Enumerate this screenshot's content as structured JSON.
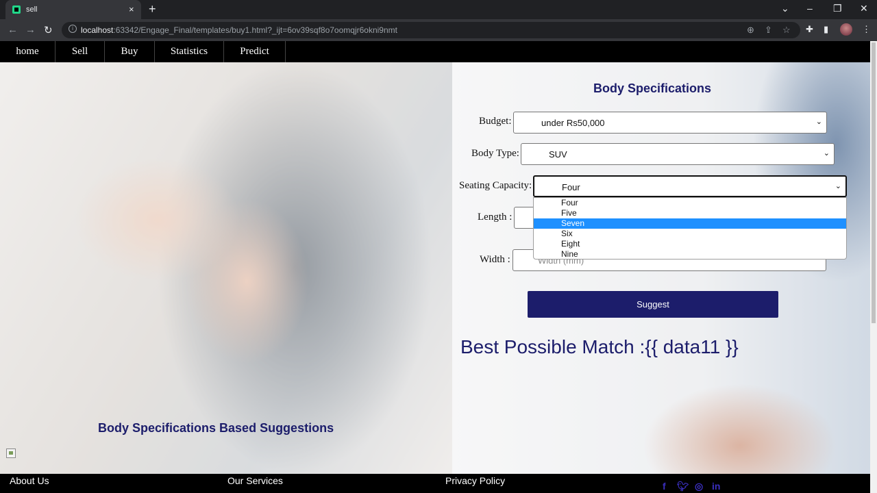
{
  "browser": {
    "tab_title": "sell",
    "tab_close": "×",
    "new_tab": "+",
    "url_host": "localhost",
    "url_path": ":63342/Engage_Final/templates/buy1.html?_ijt=6ov39sqf8o7oomqjr6okni9nmt"
  },
  "nav": {
    "items": [
      "home",
      "Sell",
      "Buy",
      "Statistics",
      "Predict"
    ]
  },
  "form": {
    "title": "Body Specifications",
    "budget_label": "Budget:",
    "budget_value": "under Rs50,000",
    "body_type_label": "Body Type:",
    "body_type_value": "SUV",
    "seating_label": "Seating Capacity:",
    "seating_value": "Four",
    "seating_options": [
      "Four",
      "Five",
      "Seven",
      "Six",
      "Eight",
      "Nine"
    ],
    "seating_highlighted": "Seven",
    "length_label": "Length :",
    "width_label": "Width :",
    "width_placeholder": "Width (mm)",
    "suggest_label": "Suggest"
  },
  "result": {
    "text": "Best Possible Match :{{ data11 }}"
  },
  "left_caption": "Body Specifications Based Suggestions",
  "footer": {
    "about": "About Us",
    "services": "Our Services",
    "privacy": "Privacy Policy",
    "social_icons": [
      "facebook-icon",
      "twitter-icon",
      "instagram-icon",
      "linkedin-icon"
    ]
  },
  "colors": {
    "accent": "#1c1d6b",
    "highlight": "#1e90ff"
  }
}
